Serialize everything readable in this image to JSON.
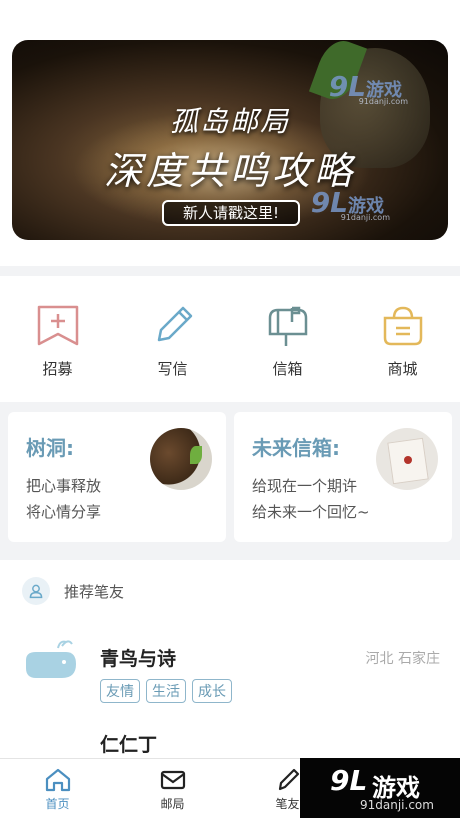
{
  "banner": {
    "title_line1": "孤岛邮局",
    "title_line2": "深度共鸣攻略",
    "button_label": "新人请戳这里!",
    "watermark_num": "9L",
    "watermark_text": "游戏",
    "watermark_url": "91danji.com"
  },
  "menu": {
    "items": [
      {
        "label": "招募",
        "icon": "recruit-flag-icon",
        "color": "#d98f8f"
      },
      {
        "label": "写信",
        "icon": "pencil-icon",
        "color": "#6aa9c9"
      },
      {
        "label": "信箱",
        "icon": "mailbox-icon",
        "color": "#6b8f92"
      },
      {
        "label": "商城",
        "icon": "shopping-bag-icon",
        "color": "#e3b85a"
      }
    ]
  },
  "cards": {
    "tree_hole": {
      "title": "树洞:",
      "line1": "把心事释放",
      "line2": "将心情分享"
    },
    "future_mailbox": {
      "title": "未来信箱:",
      "line1": "给现在一个期许",
      "line2": "给未来一个回忆~"
    }
  },
  "recommend": {
    "section_title": "推荐笔友",
    "friends": [
      {
        "name": "青鸟与诗",
        "location": "河北 石家庄",
        "tags": [
          "友情",
          "生活",
          "成长"
        ]
      }
    ],
    "next_name_partial": "仁仁丁"
  },
  "tabbar": {
    "tabs": [
      {
        "label": "首页",
        "active": true
      },
      {
        "label": "邮局",
        "active": false
      },
      {
        "label": "笔友",
        "active": false
      }
    ]
  },
  "brand": {
    "num": "9L",
    "text": "游戏",
    "url": "91danji.com"
  },
  "colors": {
    "accent": "#6a9bb5",
    "active_tab": "#4b8fc0"
  }
}
